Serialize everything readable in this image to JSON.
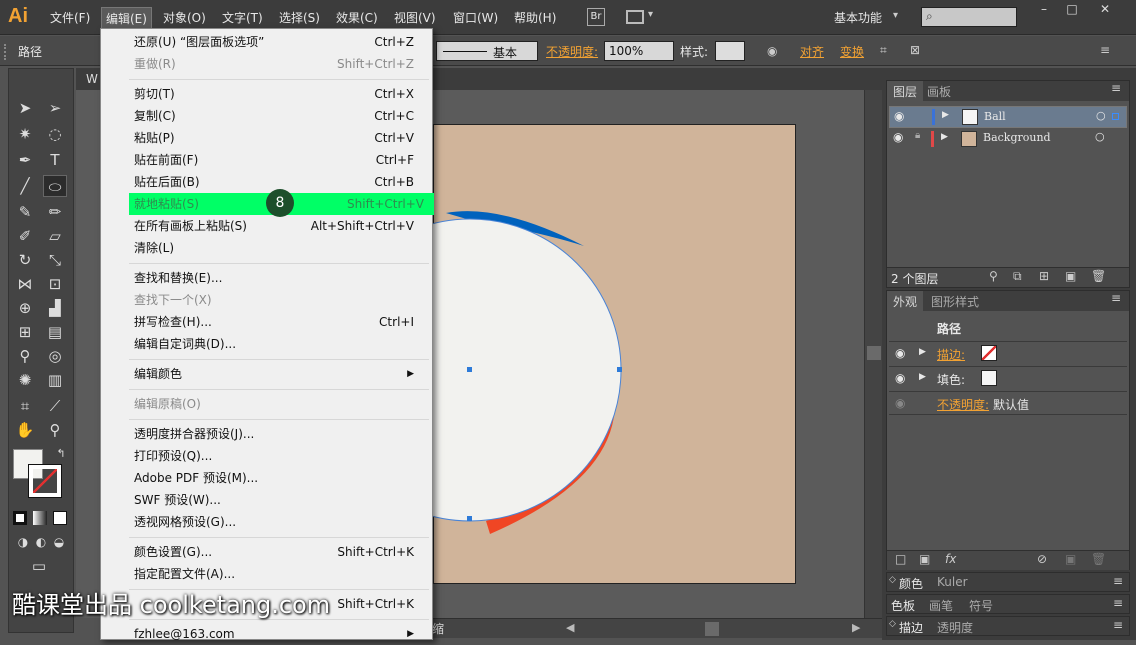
{
  "app": {
    "logo": "Ai",
    "workspace": "基本功能",
    "br": "Br"
  },
  "menus": [
    "文件(F)",
    "编辑(E)",
    "对象(O)",
    "文字(T)",
    "选择(S)",
    "效果(C)",
    "视图(V)",
    "窗口(W)",
    "帮助(H)"
  ],
  "control": {
    "selection": "路径",
    "stroke_label": "基本",
    "opacity_label": "不透明度:",
    "opacity_value": "100%",
    "style_label": "样式:",
    "align_label": "对齐",
    "transform_label": "变换"
  },
  "doc_tab": "W",
  "edit_menu": [
    {
      "label": "还原(U) “图层面板选项”",
      "shortcut": "Ctrl+Z",
      "disabled": false
    },
    {
      "label": "重做(R)",
      "shortcut": "Shift+Ctrl+Z",
      "disabled": true
    },
    {
      "label": "剪切(T)",
      "shortcut": "Ctrl+X",
      "disabled": false
    },
    {
      "label": "复制(C)",
      "shortcut": "Ctrl+C",
      "disabled": false
    },
    {
      "label": "粘贴(P)",
      "shortcut": "Ctrl+V",
      "disabled": false
    },
    {
      "label": "贴在前面(F)",
      "shortcut": "Ctrl+F",
      "disabled": false
    },
    {
      "label": "贴在后面(B)",
      "shortcut": "Ctrl+B",
      "disabled": false
    },
    {
      "label": "就地粘贴(S)",
      "shortcut": "Shift+Ctrl+V",
      "disabled": false
    },
    {
      "label": "在所有画板上粘贴(S)",
      "shortcut": "Alt+Shift+Ctrl+V",
      "disabled": false
    },
    {
      "label": "清除(L)",
      "shortcut": "",
      "disabled": false
    },
    {
      "label": "查找和替换(E)...",
      "shortcut": "",
      "disabled": false
    },
    {
      "label": "查找下一个(X)",
      "shortcut": "",
      "disabled": true
    },
    {
      "label": "拼写检查(H)...",
      "shortcut": "Ctrl+I",
      "disabled": false
    },
    {
      "label": "编辑自定词典(D)...",
      "shortcut": "",
      "disabled": false
    },
    {
      "label": "编辑颜色",
      "shortcut": "",
      "disabled": false
    },
    {
      "label": "编辑原稿(O)",
      "shortcut": "",
      "disabled": true
    },
    {
      "label": "透明度拼合器预设(J)...",
      "shortcut": "",
      "disabled": false
    },
    {
      "label": "打印预设(Q)...",
      "shortcut": "",
      "disabled": false
    },
    {
      "label": "Adobe PDF 预设(M)...",
      "shortcut": "",
      "disabled": false
    },
    {
      "label": "SWF 预设(W)...",
      "shortcut": "",
      "disabled": false
    },
    {
      "label": "透视网格预设(G)...",
      "shortcut": "",
      "disabled": false
    },
    {
      "label": "颜色设置(G)...",
      "shortcut": "Shift+Ctrl+K",
      "disabled": false
    },
    {
      "label": "指定配置文件(A)...",
      "shortcut": "",
      "disabled": false
    },
    {
      "label": "",
      "shortcut": "Shift+Ctrl+K",
      "disabled": false
    },
    {
      "label": "fzhlee@163.com",
      "shortcut": "",
      "disabled": false
    }
  ],
  "step_badge": "8",
  "layers_panel": {
    "tabs": [
      "图层",
      "画板"
    ],
    "layers": [
      "Ball",
      "Background"
    ],
    "count": "2 个图层"
  },
  "appearance_panel": {
    "tabs": [
      "外观",
      "图形样式"
    ],
    "title": "路径",
    "stroke": "描边:",
    "fill": "填色:",
    "opacity": "不透明度:",
    "opacity_value": "默认值"
  },
  "bottom_panels": [
    [
      "颜色",
      "Kuler"
    ],
    [
      "色板",
      "画笔",
      "符号"
    ],
    [
      "描边",
      "透明度"
    ]
  ],
  "status": {
    "zoom": "缩"
  },
  "watermark": "酷课堂出品 coolketang.com",
  "colors": {
    "highlight": "#00ff66",
    "artboard": "#d0b49a",
    "ball": "#f2f2ef",
    "accent_blue": "#0062bd",
    "accent_red": "#f04624"
  }
}
